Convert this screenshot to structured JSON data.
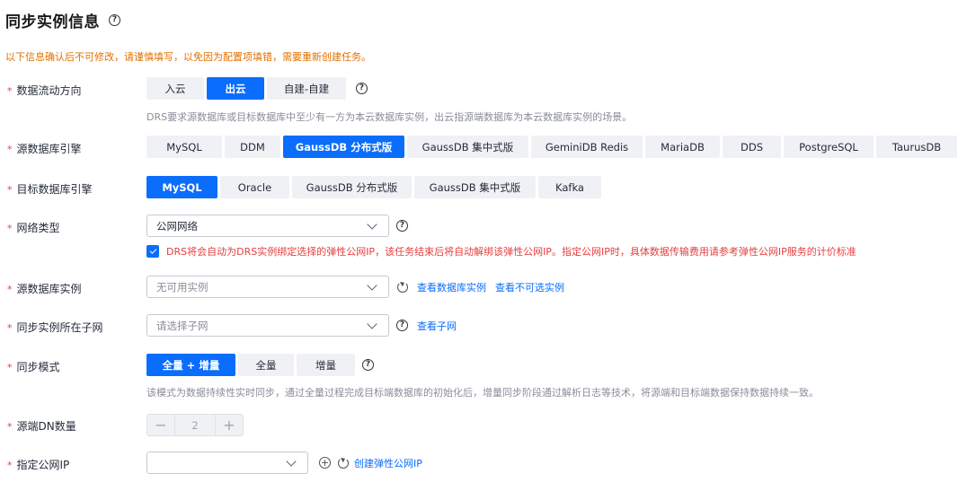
{
  "page": {
    "title": "同步实例信息",
    "notice": "以下信息确认后不可修改，请谨慎填写，以免因为配置项填错，需要重新创建任务。"
  },
  "direction": {
    "label": "数据流动方向",
    "options": [
      "入云",
      "出云",
      "自建-自建"
    ],
    "selected": "出云",
    "hint": "DRS要求源数据库或目标数据库中至少有一方为本云数据库实例，出云指源端数据库为本云数据库实例的场景。"
  },
  "source_engine": {
    "label": "源数据库引擎",
    "options": [
      "MySQL",
      "DDM",
      "GaussDB 分布式版",
      "GaussDB 集中式版",
      "GeminiDB Redis",
      "MariaDB",
      "DDS",
      "PostgreSQL",
      "TaurusDB"
    ],
    "selected": "GaussDB 分布式版"
  },
  "target_engine": {
    "label": "目标数据库引擎",
    "options": [
      "MySQL",
      "Oracle",
      "GaussDB 分布式版",
      "GaussDB 集中式版",
      "Kafka"
    ],
    "selected": "MySQL"
  },
  "network": {
    "label": "网络类型",
    "value": "公网网络",
    "checkbox_text": "DRS将会自动为DRS实例绑定选择的弹性公网IP，该任务结束后将自动解绑该弹性公网IP。指定公网IP时，具体数据传输费用请参考弹性公网IP服务的计价标准"
  },
  "source_instance": {
    "label": "源数据库实例",
    "placeholder": "无可用实例",
    "link_view": "查看数据库实例",
    "link_unavailable": "查看不可选实例"
  },
  "subnet": {
    "label": "同步实例所在子网",
    "placeholder": "请选择子网",
    "link_view": "查看子网"
  },
  "sync_mode": {
    "label": "同步模式",
    "options": [
      "全量 + 增量",
      "全量",
      "增量"
    ],
    "selected": "全量 + 增量",
    "hint": "该模式为数据持续性实时同步，通过全量过程完成目标端数据库的初始化后，增量同步阶段通过解析日志等技术，将源端和目标端数据保持数据持续一致。"
  },
  "dn_count": {
    "label": "源端DN数量",
    "value": "2"
  },
  "public_ip": {
    "label": "指定公网IP",
    "value": "",
    "link_create": "创建弹性公网IP"
  },
  "colors": {
    "primary": "#0a6dfb",
    "warning": "#e07000",
    "danger": "#e63e3e"
  }
}
